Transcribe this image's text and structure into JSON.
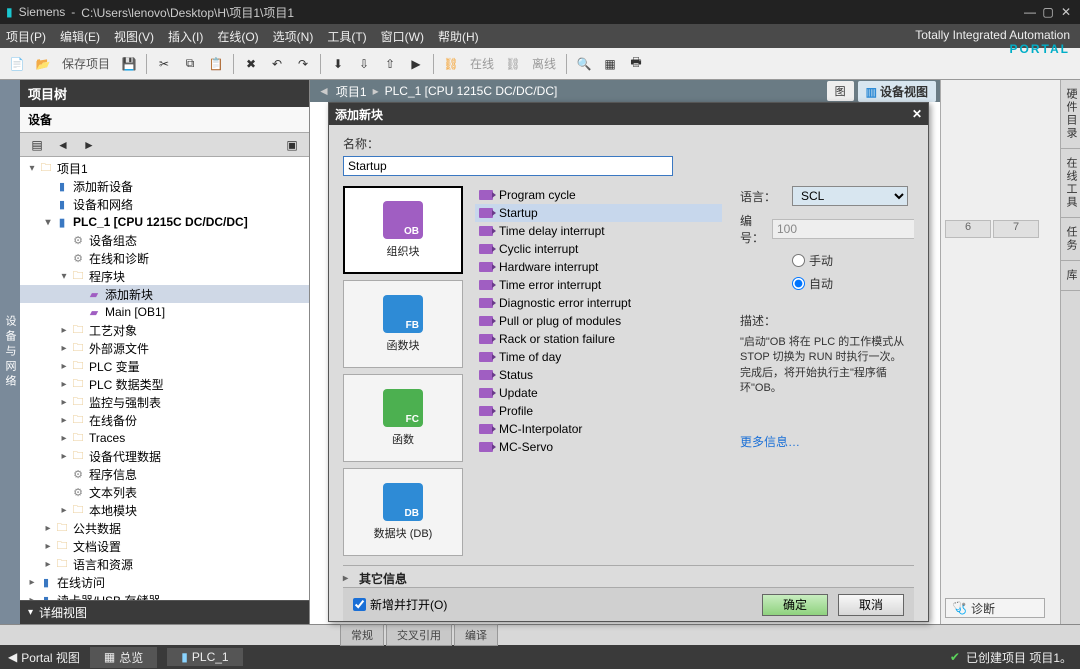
{
  "title_bar": {
    "app": "Siemens",
    "path": "C:\\Users\\lenovo\\Desktop\\H\\项目1\\项目1"
  },
  "menu": [
    "项目(P)",
    "编辑(E)",
    "视图(V)",
    "插入(I)",
    "在线(O)",
    "选项(N)",
    "工具(T)",
    "窗口(W)",
    "帮助(H)"
  ],
  "brand": {
    "line1": "Totally Integrated Automation",
    "line2": "PORTAL"
  },
  "toolbar": {
    "save": "保存项目",
    "online": "在线",
    "offline": "离线"
  },
  "left_strip": "设备与网络",
  "project_tree": {
    "title": "项目树",
    "tab": "设备",
    "rows": [
      {
        "d": 0,
        "e": "▾",
        "ic": "fold",
        "t": "项目1"
      },
      {
        "d": 1,
        "e": "",
        "ic": "dev",
        "t": "添加新设备"
      },
      {
        "d": 1,
        "e": "",
        "ic": "dev",
        "t": "设备和网络"
      },
      {
        "d": 1,
        "e": "▾",
        "ic": "dev",
        "t": "PLC_1 [CPU 1215C DC/DC/DC]",
        "bold": true
      },
      {
        "d": 2,
        "e": "",
        "ic": "gear",
        "t": "设备组态"
      },
      {
        "d": 2,
        "e": "",
        "ic": "gear",
        "t": "在线和诊断"
      },
      {
        "d": 2,
        "e": "▾",
        "ic": "fold",
        "t": "程序块"
      },
      {
        "d": 3,
        "e": "",
        "ic": "blk",
        "t": "添加新块",
        "sel": true
      },
      {
        "d": 3,
        "e": "",
        "ic": "blk",
        "t": "Main [OB1]"
      },
      {
        "d": 2,
        "e": "▸",
        "ic": "fold",
        "t": "工艺对象"
      },
      {
        "d": 2,
        "e": "▸",
        "ic": "fold",
        "t": "外部源文件"
      },
      {
        "d": 2,
        "e": "▸",
        "ic": "fold",
        "t": "PLC 变量"
      },
      {
        "d": 2,
        "e": "▸",
        "ic": "fold",
        "t": "PLC 数据类型"
      },
      {
        "d": 2,
        "e": "▸",
        "ic": "fold",
        "t": "监控与强制表"
      },
      {
        "d": 2,
        "e": "▸",
        "ic": "fold",
        "t": "在线备份"
      },
      {
        "d": 2,
        "e": "▸",
        "ic": "fold",
        "t": "Traces"
      },
      {
        "d": 2,
        "e": "▸",
        "ic": "fold",
        "t": "设备代理数据"
      },
      {
        "d": 2,
        "e": "",
        "ic": "gear",
        "t": "程序信息"
      },
      {
        "d": 2,
        "e": "",
        "ic": "gear",
        "t": "文本列表"
      },
      {
        "d": 2,
        "e": "▸",
        "ic": "fold",
        "t": "本地模块"
      },
      {
        "d": 1,
        "e": "▸",
        "ic": "fold",
        "t": "公共数据"
      },
      {
        "d": 1,
        "e": "▸",
        "ic": "fold",
        "t": "文档设置"
      },
      {
        "d": 1,
        "e": "▸",
        "ic": "fold",
        "t": "语言和资源"
      },
      {
        "d": 0,
        "e": "▸",
        "ic": "dev",
        "t": "在线访问"
      },
      {
        "d": 0,
        "e": "▸",
        "ic": "dev",
        "t": "读卡器/USB 存储器"
      }
    ],
    "detail": "详细视图"
  },
  "breadcrumb": [
    "项目1",
    "PLC_1 [CPU 1215C DC/DC/DC]"
  ],
  "view_tabs": {
    "left": "图",
    "right": "设备视图"
  },
  "dialog": {
    "title": "添加新块",
    "name_label": "名称：",
    "name_value": "Startup",
    "block_types": [
      {
        "label": "组织块",
        "sub": "OB",
        "color": "#a05ec2"
      },
      {
        "label": "函数块",
        "sub": "FB",
        "color": "#2e8bd6"
      },
      {
        "label": "函数",
        "sub": "FC",
        "color": "#4cb050"
      },
      {
        "label": "数据块 (DB)",
        "sub": "DB",
        "color": "#2e8bd6"
      }
    ],
    "ob_list": [
      "Program cycle",
      "Startup",
      "Time delay interrupt",
      "Cyclic interrupt",
      "Hardware interrupt",
      "Time error interrupt",
      "Diagnostic error interrupt",
      "Pull or plug of modules",
      "Rack or station failure",
      "Time of day",
      "Status",
      "Update",
      "Profile",
      "MC-Interpolator",
      "MC-Servo"
    ],
    "ob_selected": "Startup",
    "lang_label": "语言：",
    "lang_value": "SCL",
    "num_label": "编号：",
    "num_value": "100",
    "radio_manual": "手动",
    "radio_auto": "自动",
    "desc_label": "描述：",
    "desc_text": "\"启动\"OB 将在 PLC 的工作模式从 STOP 切换为 RUN 时执行一次。完成后，将开始执行主\"程序循环\"OB。",
    "more": "更多信息…",
    "other_info": "其它信息",
    "checkbox": "新增并打开(O)",
    "ok": "确定",
    "cancel": "取消"
  },
  "right": {
    "cells": [
      "6",
      "7"
    ],
    "tabs": [
      "硬件目录",
      "在线工具",
      "任务",
      "库"
    ],
    "diag": "诊断"
  },
  "bottom_tabs": [
    "常规",
    "交叉引用",
    "编译"
  ],
  "status": {
    "portal": "Portal 视图",
    "tabs": [
      "总览",
      "PLC_1"
    ],
    "msg": "已创建项目 项目1。"
  }
}
